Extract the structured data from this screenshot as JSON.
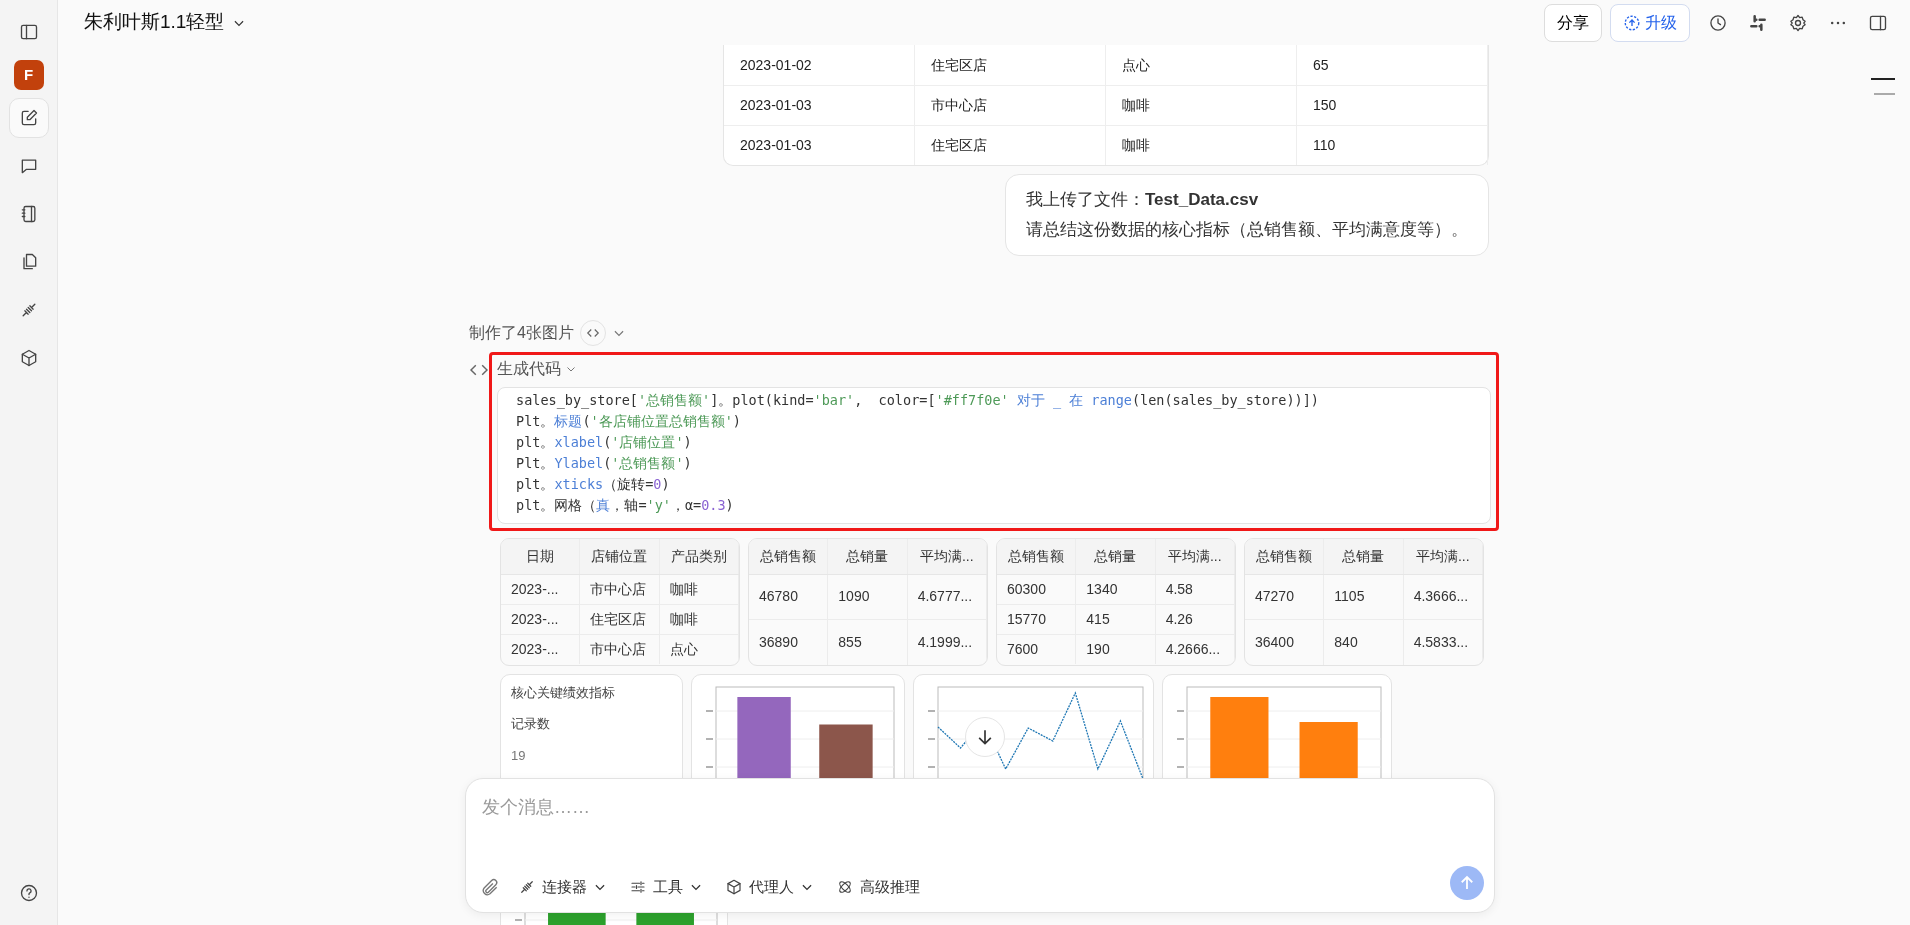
{
  "sidebar": {
    "avatar": "F",
    "items": [
      {
        "kind": "compose",
        "selected": true
      },
      {
        "kind": "chat",
        "selected": false
      },
      {
        "kind": "notebook",
        "selected": false
      },
      {
        "kind": "files",
        "selected": false
      },
      {
        "kind": "plug",
        "selected": false
      },
      {
        "kind": "cube",
        "selected": false
      }
    ]
  },
  "header": {
    "title": "朱利叶斯1.1轻型",
    "share": "分享",
    "upgrade": "升级"
  },
  "data_table": {
    "rows": [
      [
        "2023-01-02",
        "住宅区店",
        "点心",
        "65"
      ],
      [
        "2023-01-03",
        "市中心店",
        "咖啡",
        "150"
      ],
      [
        "2023-01-03",
        "住宅区店",
        "咖啡",
        "110"
      ]
    ]
  },
  "user_message": {
    "lines": [
      "我上传了文件：**Test_Data.csv**",
      "请总结这份数据的核心指标（总销售额、平均满意度等）。"
    ]
  },
  "images_note": "制作了4张图片",
  "code_section": {
    "title": "生成代码",
    "lines": [
      [
        {
          "kind": "plain",
          "text": "sales_by_store["
        },
        {
          "kind": "string",
          "text": "'总销售额'"
        },
        {
          "kind": "plain",
          "text": "]。plot(kind="
        },
        {
          "kind": "string",
          "text": "'bar'"
        },
        {
          "kind": "plain",
          "text": ",  color=["
        },
        {
          "kind": "string",
          "text": "'#ff7f0e'"
        },
        {
          "kind": "keyword",
          "text": " 对于 _ 在 range"
        },
        {
          "kind": "plain",
          "text": "(len(sales_by_store))])"
        }
      ],
      [
        {
          "kind": "plain",
          "text": "Plt。"
        },
        {
          "kind": "keyword",
          "text": "标题"
        },
        {
          "kind": "plain",
          "text": "("
        },
        {
          "kind": "string",
          "text": "'各店铺位置总销售额'"
        },
        {
          "kind": "plain",
          "text": ")"
        }
      ],
      [
        {
          "kind": "plain",
          "text": "plt。"
        },
        {
          "kind": "keyword",
          "text": "xlabel"
        },
        {
          "kind": "plain",
          "text": "("
        },
        {
          "kind": "string",
          "text": "'店铺位置'"
        },
        {
          "kind": "plain",
          "text": ")"
        }
      ],
      [
        {
          "kind": "plain",
          "text": "Plt。"
        },
        {
          "kind": "keyword",
          "text": "Ylabel"
        },
        {
          "kind": "plain",
          "text": "("
        },
        {
          "kind": "string",
          "text": "'总销售额'"
        },
        {
          "kind": "plain",
          "text": ")"
        }
      ],
      [
        {
          "kind": "plain",
          "text": "plt。"
        },
        {
          "kind": "keyword",
          "text": "xticks"
        },
        {
          "kind": "plain",
          "text": "（旋转="
        },
        {
          "kind": "number",
          "text": "0"
        },
        {
          "kind": "plain",
          "text": ")"
        }
      ],
      [
        {
          "kind": "plain",
          "text": "plt。网格（"
        },
        {
          "kind": "keyword",
          "text": "真"
        },
        {
          "kind": "plain",
          "text": "，轴="
        },
        {
          "kind": "string",
          "text": "'y'"
        },
        {
          "kind": "plain",
          "text": "，α="
        },
        {
          "kind": "number",
          "text": "0.3"
        },
        {
          "kind": "plain",
          "text": ")"
        }
      ]
    ]
  },
  "mini_tables": [
    {
      "columns": [
        "日期",
        "店铺位置",
        "产品类别"
      ],
      "rows": [
        [
          "2023-...",
          "市中心店",
          "咖啡"
        ],
        [
          "2023-...",
          "住宅区店",
          "咖啡"
        ],
        [
          "2023-...",
          "市中心店",
          "点心"
        ]
      ]
    },
    {
      "columns": [
        "总销售额",
        "总销量",
        "平均满..."
      ],
      "rows": [
        [
          "46780",
          "1090",
          "4.6777..."
        ],
        [
          "36890",
          "855",
          "4.1999..."
        ]
      ]
    },
    {
      "columns": [
        "总销售额",
        "总销量",
        "平均满..."
      ],
      "rows": [
        [
          "60300",
          "1340",
          "4.58"
        ],
        [
          "15770",
          "415",
          "4.26"
        ],
        [
          "7600",
          "190",
          "4.2666..."
        ]
      ]
    },
    {
      "columns": [
        "总销售额",
        "总销量",
        "平均满..."
      ],
      "rows": [
        [
          "47270",
          "1105",
          "4.3666..."
        ],
        [
          "36400",
          "840",
          "4.5833..."
        ]
      ]
    }
  ],
  "kpi_card": {
    "title": "核心关键绩效指标",
    "label": "记录数",
    "value": "19"
  },
  "charts": [
    {
      "kind": "bar"
    },
    {
      "kind": "line"
    },
    {
      "kind": "bar"
    },
    {
      "kind": "bar"
    }
  ],
  "composer": {
    "placeholder": "发个消息……",
    "tools": [
      {
        "kind": "connector",
        "label": "连接器",
        "dropdown": true
      },
      {
        "kind": "tools",
        "label": "工具",
        "dropdown": true
      },
      {
        "kind": "agent",
        "label": "代理人",
        "dropdown": true
      },
      {
        "kind": "reasoning",
        "label": "高级推理",
        "dropdown": false
      }
    ]
  }
}
